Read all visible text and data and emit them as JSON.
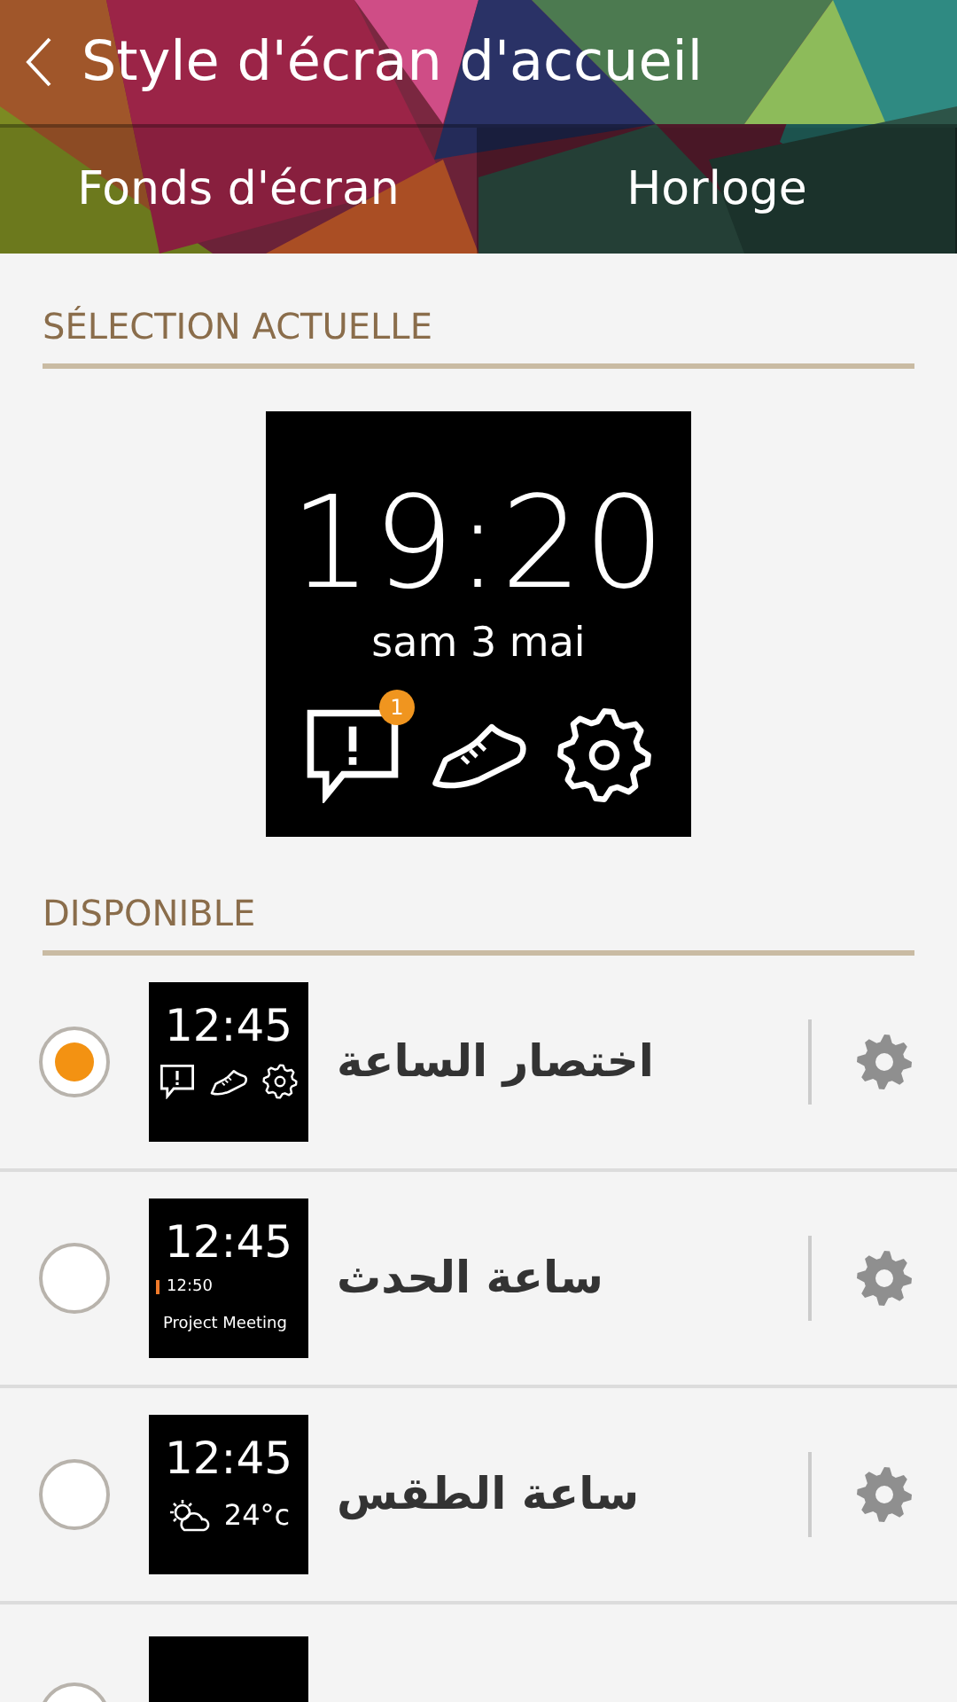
{
  "header": {
    "title": "Style d'écran d'accueil"
  },
  "tabs": [
    {
      "label": "Fonds d'écran",
      "selected": false
    },
    {
      "label": "Horloge",
      "selected": true
    }
  ],
  "current": {
    "heading": "SÉLECTION ACTUELLE",
    "time": "19:20",
    "date": "sam 3 mai",
    "notification_count": "1"
  },
  "available": {
    "heading": "DISPONIBLE",
    "items": [
      {
        "kind": "shortcuts",
        "name": "اختصار الساعة",
        "selected": true,
        "time": "12:45"
      },
      {
        "kind": "event",
        "name": "ساعة الحدث",
        "selected": false,
        "time": "12:45",
        "event_time": "12:50",
        "event_title": "Project Meeting"
      },
      {
        "kind": "weather",
        "name": "ساعة الطقس",
        "selected": false,
        "time": "12:45",
        "temperature": "24°c"
      },
      {
        "kind": "blank",
        "selected": false
      }
    ]
  }
}
